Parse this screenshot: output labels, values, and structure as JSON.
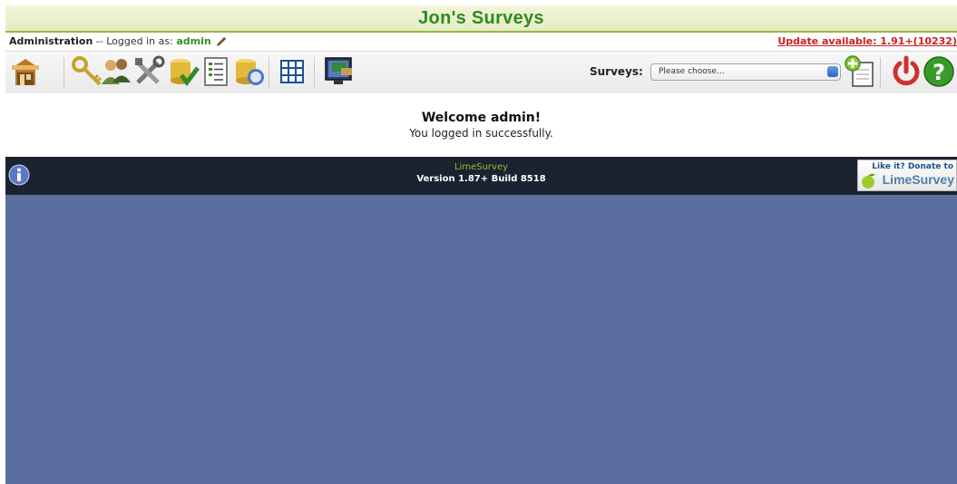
{
  "header": {
    "title": "Jon's Surveys"
  },
  "admin_bar": {
    "section": "Administration",
    "logged_in_prefix": "-- Logged in as:",
    "username": "admin",
    "update_link": "Update available: 1.91+(10232)"
  },
  "toolbar": {
    "icons": [
      "home-icon",
      "security-icon",
      "user-groups-icon",
      "global-settings-icon",
      "check-data-integrity-icon",
      "backup-database-icon",
      "restore-sql-icon",
      "label-sets-icon",
      "template-editor-icon"
    ],
    "surveys_label": "Surveys:",
    "surveys_select_value": "Please choose...",
    "right_icons": [
      "create-survey-icon",
      "logout-icon",
      "help-icon"
    ]
  },
  "welcome": {
    "title": "Welcome admin!",
    "message": "You logged in successfully."
  },
  "footer": {
    "brand": "LimeSurvey",
    "version": "Version 1.87+ Build 8518",
    "donate_top": "Like it? Donate to",
    "donate_brand": "LimeSurvey"
  },
  "colors": {
    "title_green": "#2f8a22",
    "update_red": "#cc2020",
    "footer_bg": "#1c2330",
    "body_bg": "#5b6ea0"
  }
}
